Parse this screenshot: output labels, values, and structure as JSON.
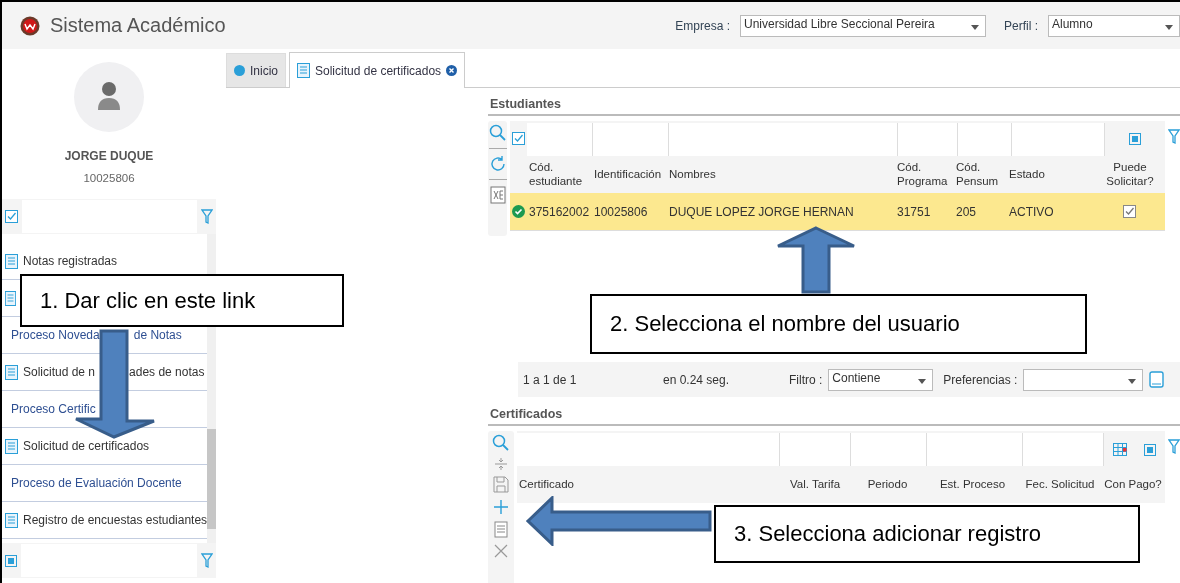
{
  "header": {
    "title": "Sistema Académico",
    "company": {
      "label": "Empresa :",
      "value": "Universidad Libre Seccional Pereira"
    },
    "profile": {
      "label": "Perfil :",
      "value": "Alumno"
    }
  },
  "user": {
    "name": "JORGE DUQUE",
    "id": "10025806"
  },
  "menu_filter": {
    "checked": true
  },
  "menu": [
    {
      "kind": "page",
      "label_parts": [
        "Notas registradas"
      ]
    },
    {
      "kind": "page"
    },
    {
      "kind": "process",
      "label_parts": [
        "Proceso Noveda",
        "de Notas"
      ]
    },
    {
      "kind": "page",
      "label_parts": [
        "Solicitud de n",
        "ades de notas"
      ]
    },
    {
      "kind": "process",
      "label_parts": [
        "Proceso Certific"
      ]
    },
    {
      "kind": "page",
      "label_parts": [
        "Solicitud de certificados"
      ]
    },
    {
      "kind": "process",
      "label_parts": [
        "Proceso de Evaluación Docente"
      ]
    },
    {
      "kind": "page",
      "label_parts": [
        "Registro de encuestas estudiantes"
      ]
    }
  ],
  "tabs": [
    {
      "kind": "home",
      "label": "Inicio",
      "selected": false
    },
    {
      "kind": "form",
      "label": "Solicitud de certificados",
      "selected": true
    }
  ],
  "students": {
    "title": "Estudiantes",
    "select_all": {
      "checked": true
    },
    "columns": [
      "Cód. estudiante",
      "Identificación",
      "Nombres",
      "Cód. Programa",
      "Cód. Pensum",
      "Estado",
      "Puede Solicitar?"
    ],
    "rows": [
      {
        "selected": true,
        "valid": true,
        "cells": [
          "375162002",
          "10025806",
          "DUQUE LOPEZ JORGE HERNAN",
          "31751",
          "205",
          "ACTIVO"
        ],
        "can_request": true
      }
    ]
  },
  "pager": {
    "range": "1 a 1 de 1",
    "time": "en 0.24 seg.",
    "filter": {
      "label": "Filtro :",
      "value": "Contiene"
    },
    "preferences": {
      "label": "Preferencias :"
    }
  },
  "certificates": {
    "title": "Certificados",
    "columns": [
      "Certificado",
      "Val. Tarifa",
      "Periodo",
      "Est. Proceso",
      "Fec. Solicitud",
      "Con Pago?"
    ]
  },
  "callouts": [
    {
      "text": "1. Dar clic en este link"
    },
    {
      "text": "2. Selecciona el nombre del usuario"
    },
    {
      "text": "3. Selecciona adicionar registro"
    }
  ]
}
